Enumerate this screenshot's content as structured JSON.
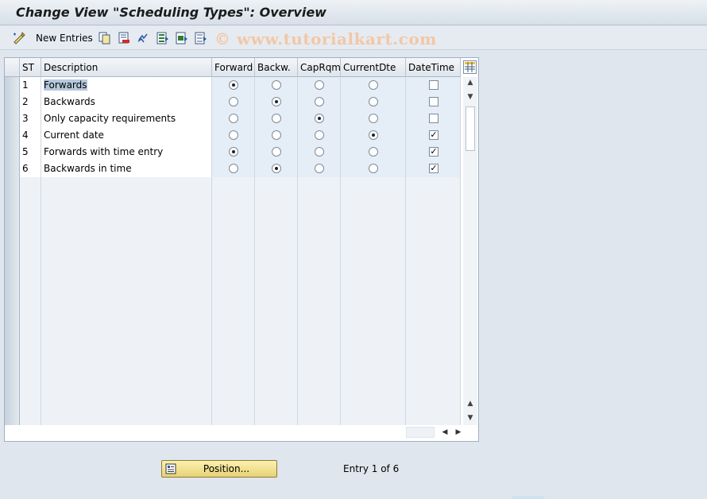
{
  "window": {
    "title": "Change View \"Scheduling Types\": Overview"
  },
  "toolbar": {
    "new_entries_label": "New Entries",
    "icons": [
      "edit-toggle-icon",
      "copy-icon",
      "delete-icon",
      "undo-icon",
      "select-all-icon",
      "select-block-icon",
      "deselect-all-icon"
    ]
  },
  "watermark": "© www.tutorialkart.com",
  "table": {
    "columns": {
      "st": "ST",
      "description": "Description",
      "forward": "Forward",
      "backward": "Backw.",
      "caprqmt": "CapRqmt",
      "currentdte": "CurrentDte",
      "datetime": "DateTime"
    },
    "rows": [
      {
        "st": "1",
        "description": "Forwards",
        "forward": true,
        "backward": false,
        "caprqmt": false,
        "currentdte": false,
        "datetime": false
      },
      {
        "st": "2",
        "description": "Backwards",
        "forward": false,
        "backward": true,
        "caprqmt": false,
        "currentdte": false,
        "datetime": false
      },
      {
        "st": "3",
        "description": "Only capacity requirements",
        "forward": false,
        "backward": false,
        "caprqmt": true,
        "currentdte": false,
        "datetime": false
      },
      {
        "st": "4",
        "description": "Current date",
        "forward": false,
        "backward": false,
        "caprqmt": false,
        "currentdte": true,
        "datetime": true
      },
      {
        "st": "5",
        "description": "Forwards with time entry",
        "forward": true,
        "backward": false,
        "caprqmt": false,
        "currentdte": false,
        "datetime": true
      },
      {
        "st": "6",
        "description": "Backwards in time",
        "forward": false,
        "backward": true,
        "caprqmt": false,
        "currentdte": false,
        "datetime": true
      }
    ],
    "empty_rows": 15
  },
  "footer": {
    "position_button_label": "Position...",
    "entry_info": "Entry 1 of 6"
  },
  "colors": {
    "accent_button": "#f0dc8a",
    "edit_cell": "#e5eef6",
    "selected_text_bg": "#b6c8dc"
  }
}
